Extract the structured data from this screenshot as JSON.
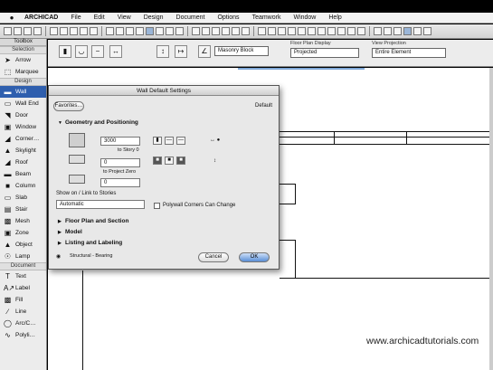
{
  "menubar": {
    "items": [
      "ARCHICAD",
      "File",
      "Edit",
      "View",
      "Design",
      "Document",
      "Options",
      "Teamwork",
      "Window",
      "Help"
    ]
  },
  "toolbox": {
    "title": "Toolbox",
    "sections": [
      {
        "header": "Selection",
        "tools": [
          {
            "label": "Arrow",
            "icon": "arrow-icon"
          },
          {
            "label": "Marquee",
            "icon": "marquee-icon"
          }
        ]
      },
      {
        "header": "Design",
        "tools": [
          {
            "label": "Wall",
            "icon": "wall-icon",
            "selected": true
          },
          {
            "label": "Wall End",
            "icon": "wall-end-icon"
          },
          {
            "label": "Door",
            "icon": "door-icon"
          },
          {
            "label": "Window",
            "icon": "window-icon"
          },
          {
            "label": "Corner…",
            "icon": "corner-window-icon"
          },
          {
            "label": "Skylight",
            "icon": "skylight-icon"
          },
          {
            "label": "Roof",
            "icon": "roof-icon"
          },
          {
            "label": "Beam",
            "icon": "beam-icon"
          },
          {
            "label": "Column",
            "icon": "column-icon"
          },
          {
            "label": "Slab",
            "icon": "slab-icon"
          },
          {
            "label": "Stair",
            "icon": "stair-icon"
          },
          {
            "label": "Mesh",
            "icon": "mesh-icon"
          },
          {
            "label": "Zone",
            "icon": "zone-icon"
          },
          {
            "label": "Object",
            "icon": "object-icon"
          },
          {
            "label": "Lamp",
            "icon": "lamp-icon"
          }
        ]
      },
      {
        "header": "Document",
        "tools": [
          {
            "label": "Text",
            "icon": "text-icon"
          },
          {
            "label": "Label",
            "icon": "label-icon"
          },
          {
            "label": "Fill",
            "icon": "fill-icon"
          },
          {
            "label": "Line",
            "icon": "line-icon"
          },
          {
            "label": "Arc/C…",
            "icon": "arc-icon"
          },
          {
            "label": "Polyli…",
            "icon": "polyline-icon"
          }
        ]
      }
    ]
  },
  "infobox": {
    "material_label": "Masonry Block",
    "floor_plan_label": "Floor Plan Display",
    "floor_plan_value": "Projected",
    "view_label": "View Projection",
    "view_value": "Entire Element"
  },
  "dialog": {
    "title": "Wall Default Settings",
    "favorites": "Favorites…",
    "default_label": "Default",
    "section_geometry": "Geometry and Positioning",
    "height_value": "3000",
    "to_story": "to Story 0",
    "base_value": "0",
    "to_project_zero": "to Project Zero",
    "offset_value": "0",
    "show_on_stories_label": "Show on / Link to Stories",
    "show_on_stories_value": "Automatic",
    "polywall_label": "Polywall Corners Can Change",
    "section_floor_plan": "Floor Plan and Section",
    "section_model": "Model",
    "section_listing": "Listing and Labeling",
    "structural_value": "Structural - Bearing",
    "cancel": "Cancel",
    "ok": "OK"
  },
  "watermark": "www.archicadtutorials.com"
}
